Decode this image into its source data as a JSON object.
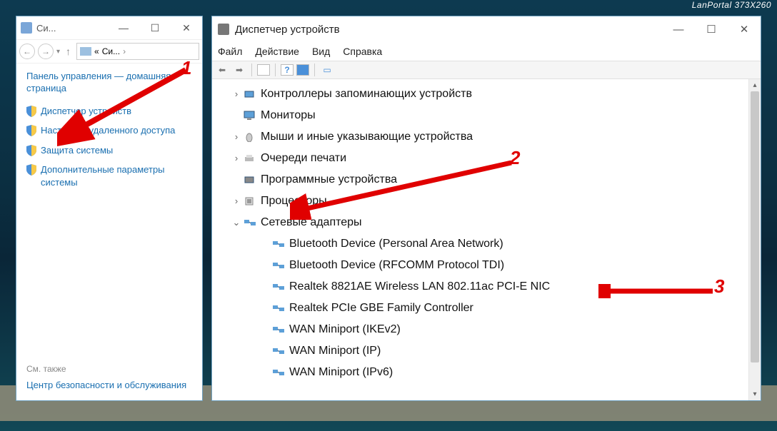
{
  "topbar": "LanPortal  373X260",
  "left": {
    "title": "Си...",
    "loc_prefix": "«",
    "loc_text": "Си...",
    "home": "Панель управления — домашняя страница",
    "links": [
      "Диспетчер устройств",
      "Настройка удаленного доступа",
      "Защита системы",
      "Дополнительные параметры системы"
    ],
    "seealso_hdr": "См. также",
    "seealso_link": "Центр безопасности и обслуживания"
  },
  "right": {
    "title": "Диспетчер устройств",
    "menu": [
      "Файл",
      "Действие",
      "Вид",
      "Справка"
    ],
    "tree": [
      {
        "level": 1,
        "exp": ">",
        "icon": "drive",
        "label": "Контроллеры запоминающих устройств"
      },
      {
        "level": 1,
        "exp": "",
        "icon": "monitor",
        "label": "Мониторы"
      },
      {
        "level": 1,
        "exp": ">",
        "icon": "mouse",
        "label": "Мыши и иные указывающие устройства"
      },
      {
        "level": 1,
        "exp": ">",
        "icon": "printer",
        "label": "Очереди печати"
      },
      {
        "level": 1,
        "exp": "",
        "icon": "board",
        "label": "Программные устройства"
      },
      {
        "level": 1,
        "exp": ">",
        "icon": "cpu",
        "label": "Процессоры"
      },
      {
        "level": 1,
        "exp": "v",
        "icon": "net",
        "label": "Сетевые адаптеры"
      },
      {
        "level": 2,
        "exp": "",
        "icon": "net",
        "label": "Bluetooth Device (Personal Area Network)"
      },
      {
        "level": 2,
        "exp": "",
        "icon": "net",
        "label": "Bluetooth Device (RFCOMM Protocol TDI)"
      },
      {
        "level": 2,
        "exp": "",
        "icon": "net",
        "label": "Realtek 8821AE Wireless LAN 802.11ac PCI-E NIC"
      },
      {
        "level": 2,
        "exp": "",
        "icon": "net",
        "label": "Realtek PCIe GBE Family Controller"
      },
      {
        "level": 2,
        "exp": "",
        "icon": "net",
        "label": "WAN Miniport (IKEv2)"
      },
      {
        "level": 2,
        "exp": "",
        "icon": "net",
        "label": "WAN Miniport (IP)"
      },
      {
        "level": 2,
        "exp": "",
        "icon": "net",
        "label": "WAN Miniport (IPv6)"
      }
    ]
  },
  "annotations": {
    "n1": "1",
    "n2": "2",
    "n3": "3"
  }
}
